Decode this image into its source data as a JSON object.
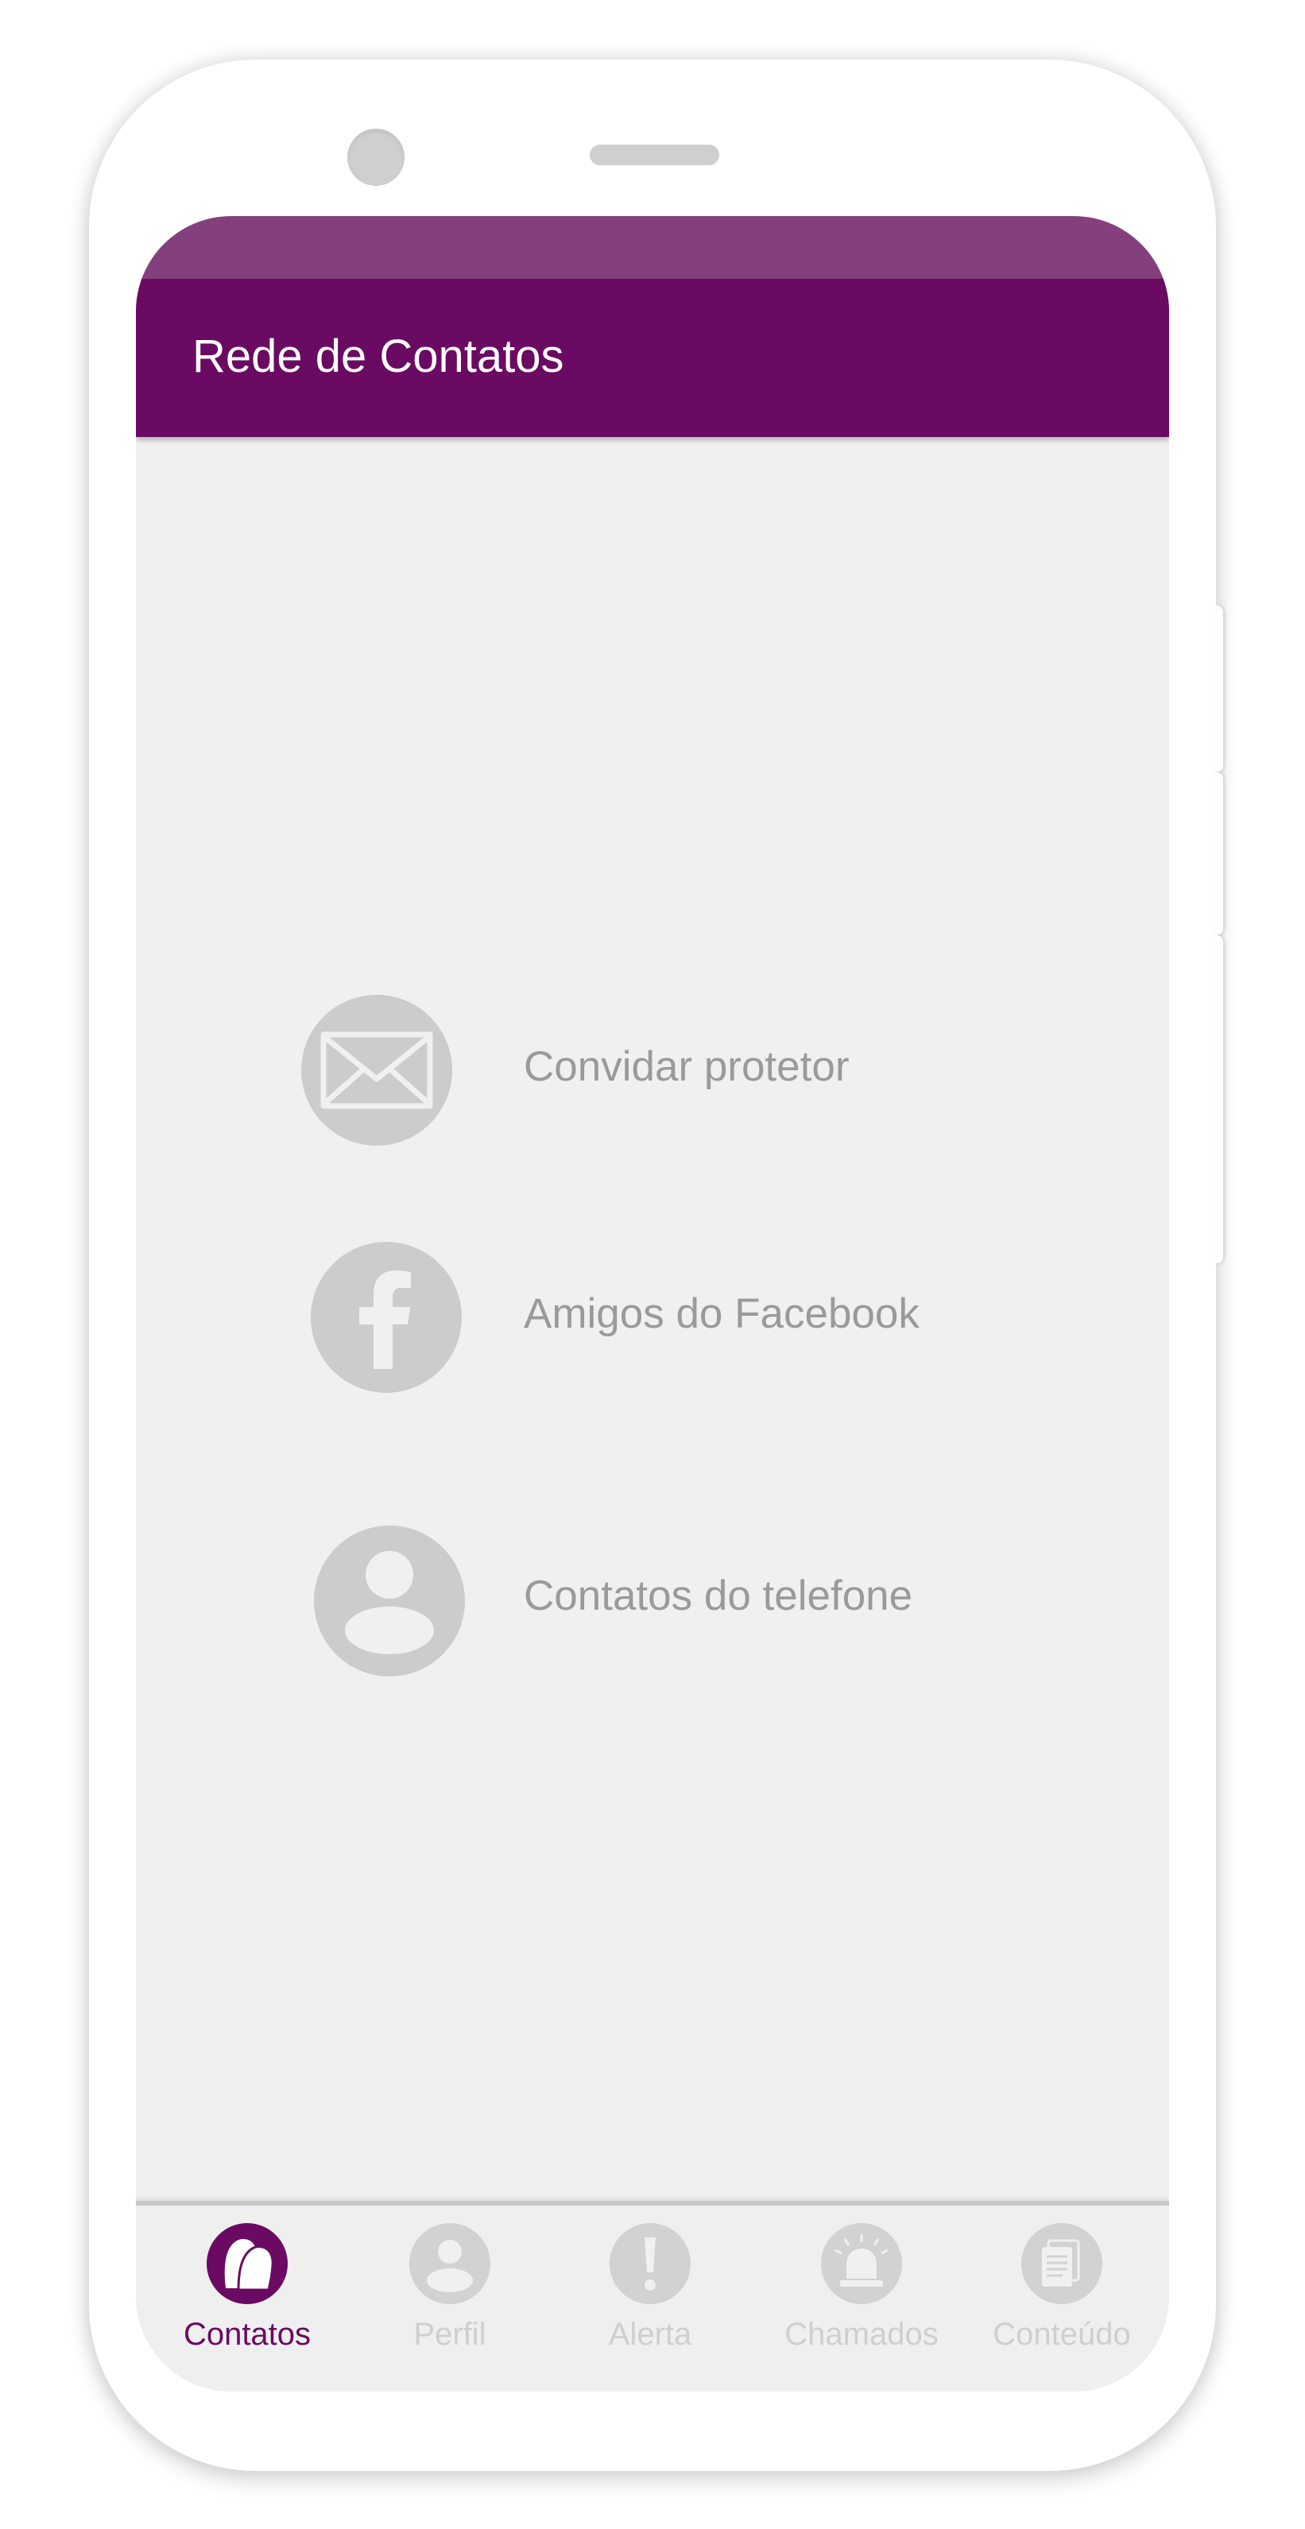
{
  "app_bar": {
    "title": "Rede de Contatos"
  },
  "colors": {
    "primary": "#6a0a62",
    "status_bar": "#84407c",
    "background": "#f0f0f0",
    "icon_gray": "#cccccc",
    "label_gray": "#9a9a9a"
  },
  "options": [
    {
      "label": "Convidar protetor",
      "icon": "envelope-icon"
    },
    {
      "label": "Amigos do Facebook",
      "icon": "facebook-icon"
    },
    {
      "label": "Contatos do telefone",
      "icon": "person-icon"
    }
  ],
  "bottom_nav": {
    "active": "Contatos",
    "items": [
      {
        "label": "Contatos",
        "icon": "contacts-icon"
      },
      {
        "label": "Perfil",
        "icon": "profile-icon"
      },
      {
        "label": "Alerta",
        "icon": "alert-icon"
      },
      {
        "label": "Chamados",
        "icon": "siren-icon"
      },
      {
        "label": "Conteúdo",
        "icon": "content-icon"
      }
    ]
  }
}
